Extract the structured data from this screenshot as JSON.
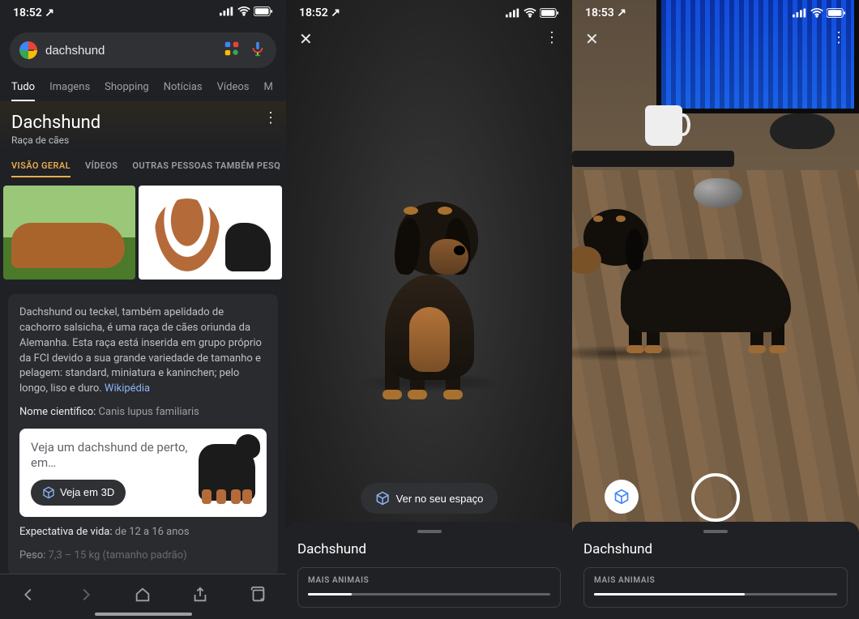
{
  "status": {
    "time_p1": "18:52",
    "time_p2": "18:52",
    "time_p3": "18:53",
    "loc_arrow": "↗"
  },
  "search": {
    "query": "dachshund"
  },
  "tabs": [
    "Tudo",
    "Imagens",
    "Shopping",
    "Notícias",
    "Vídeos",
    "M"
  ],
  "kp": {
    "title": "Dachshund",
    "subtitle": "Raça de cães",
    "tabs": [
      "VISÃO GERAL",
      "VÍDEOS",
      "OUTRAS PESSOAS TAMBÉM PESQ"
    ],
    "description": "Dachshund ou teckel, também apelidado de cachorro salsicha, é uma raça de cães oriunda da Alemanha. Esta raça está inserida em grupo próprio da FCI devido a sua grande variedade de tamanho e pelagem: standard, miniatura e kaninchen; pelo longo, liso e duro.",
    "wiki_link": "Wikipédia",
    "sci_name_label": "Nome científico:",
    "sci_name_value": "Canis lupus familiaris",
    "promo_text": "Veja um dachshund de perto, em…",
    "promo_btn": "Veja em 3D",
    "life_label": "Expectativa de vida:",
    "life_value": "de 12 a 16 anos",
    "weight_label": "Peso:",
    "weight_value": "7,3 – 15 kg (tamanho padrão)"
  },
  "viewer": {
    "ar_button": "Ver no seu espaço",
    "sheet_title": "Dachshund",
    "more_label": "MAIS ANIMAIS"
  }
}
